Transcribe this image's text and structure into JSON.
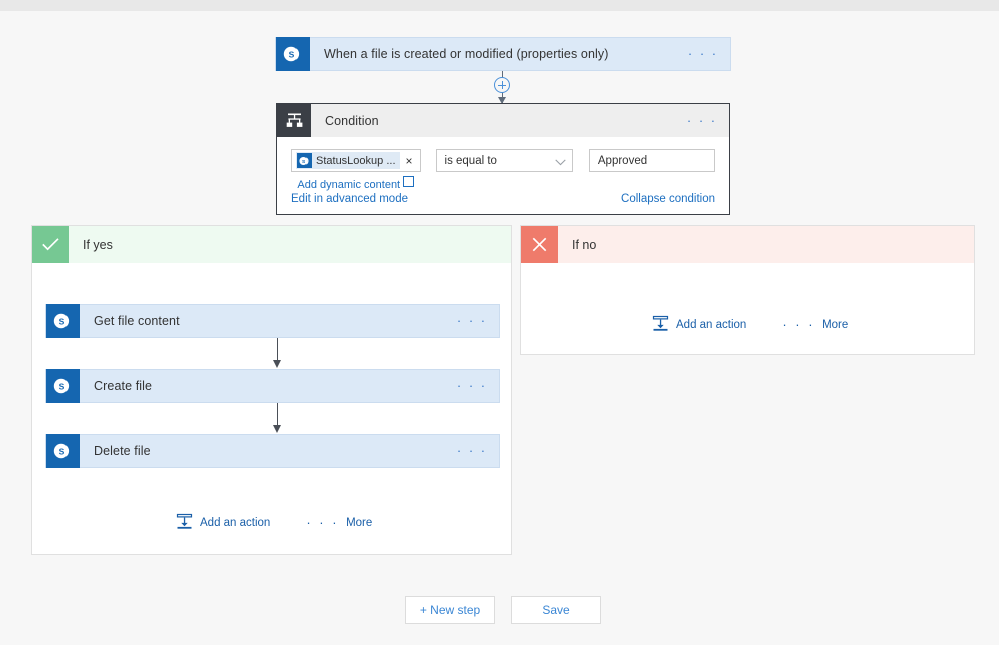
{
  "trigger": {
    "icon": "sharepoint-icon",
    "title": "When a file is created or modified (properties only)",
    "menu": "· · ·"
  },
  "connector": {
    "add_icon": "plus-circle-icon"
  },
  "condition": {
    "icon": "condition-fork-icon",
    "title": "Condition",
    "menu": "· · ·",
    "left_operand": {
      "icon": "sharepoint-token-icon",
      "label": "StatusLookup ...",
      "remove": "×"
    },
    "add_dynamic_content": "Add dynamic content",
    "dynamic_badge": "▪",
    "operator": {
      "value": "is equal to",
      "chevron": "chevron-down-icon"
    },
    "right_operand": {
      "value": "Approved"
    },
    "advanced_link": "Edit in advanced mode",
    "collapse_link": "Collapse condition"
  },
  "branch_yes": {
    "badge_icon": "check-icon",
    "label": "If yes",
    "actions": [
      {
        "icon": "sharepoint-icon",
        "title": "Get file content",
        "menu": "· · ·"
      },
      {
        "icon": "sharepoint-icon",
        "title": "Create file",
        "menu": "· · ·"
      },
      {
        "icon": "sharepoint-icon",
        "title": "Delete file",
        "menu": "· · ·"
      }
    ],
    "add_action": "Add an action",
    "more_dots": "· · ·",
    "more": "More"
  },
  "branch_no": {
    "badge_icon": "cross-icon",
    "label": "If no",
    "add_action": "Add an action",
    "more_dots": "· · ·",
    "more": "More"
  },
  "footer": {
    "new_step": "+ New step",
    "save": "Save"
  },
  "colors": {
    "accent_blue": "#1566b0",
    "link_blue": "#1d6fc0",
    "card_blue_bg": "#dce9f7",
    "yes_green": "#76c893",
    "no_red": "#ef7b6b",
    "condition_dark": "#3b3f46",
    "canvas_bg": "#f7f7f7"
  }
}
